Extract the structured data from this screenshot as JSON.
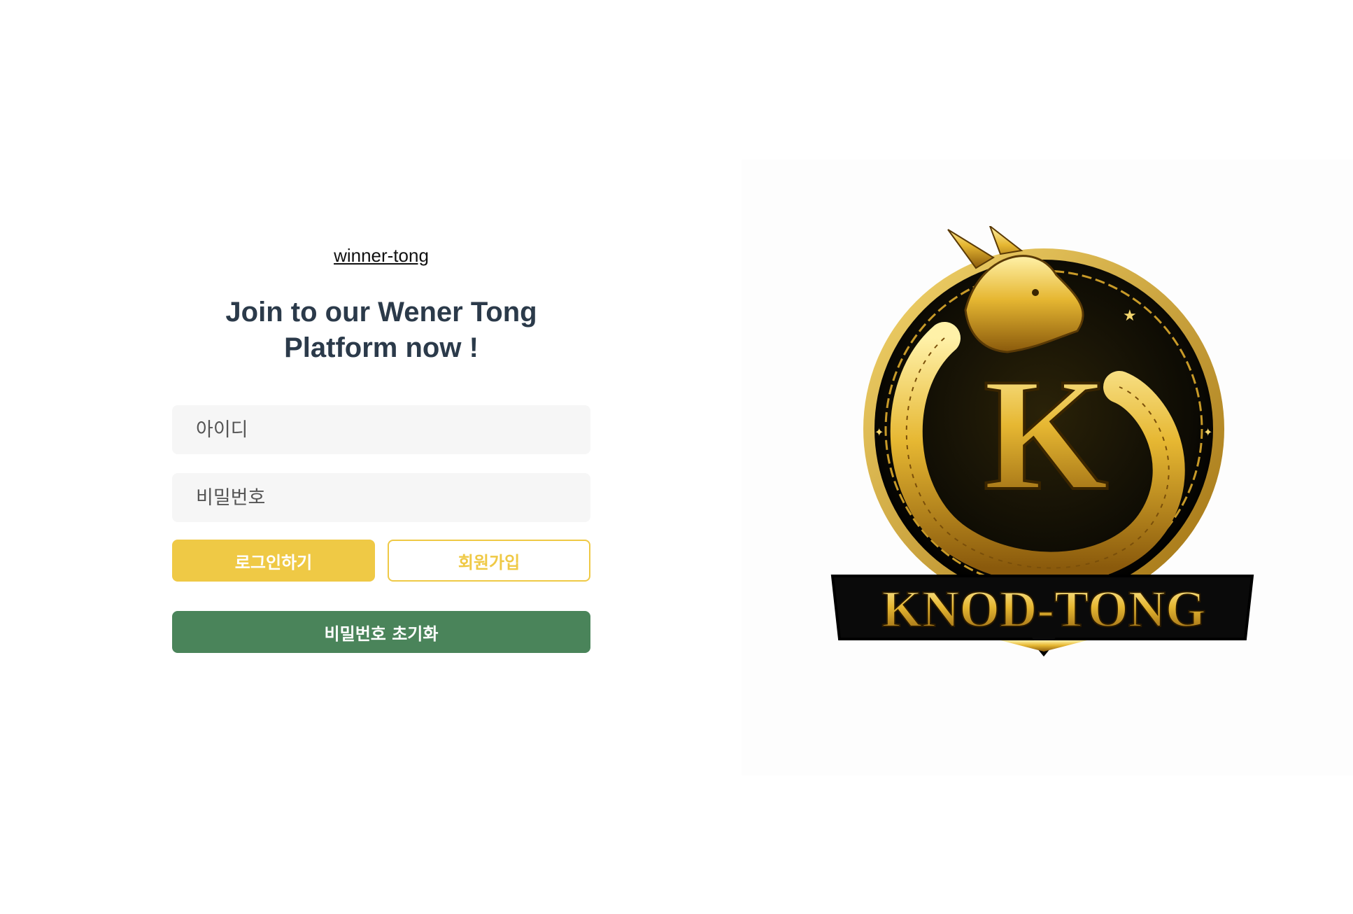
{
  "site_link": "winner-tong",
  "headline_line1": "Join to our Wener Tong",
  "headline_line2": "Platform now !",
  "form": {
    "id_placeholder": "아이디",
    "password_placeholder": "비밀번호",
    "id_value": "",
    "password_value": ""
  },
  "buttons": {
    "login": "로그인하기",
    "signup": "회원가입",
    "reset_password": "비밀번호 초기화"
  },
  "logo": {
    "brand_text": "KNOD-TONG",
    "monogram": "K"
  },
  "colors": {
    "accent_yellow": "#efc945",
    "reset_green": "#4a845a",
    "headline": "#2b3a4a",
    "gold": "#d4a017"
  }
}
